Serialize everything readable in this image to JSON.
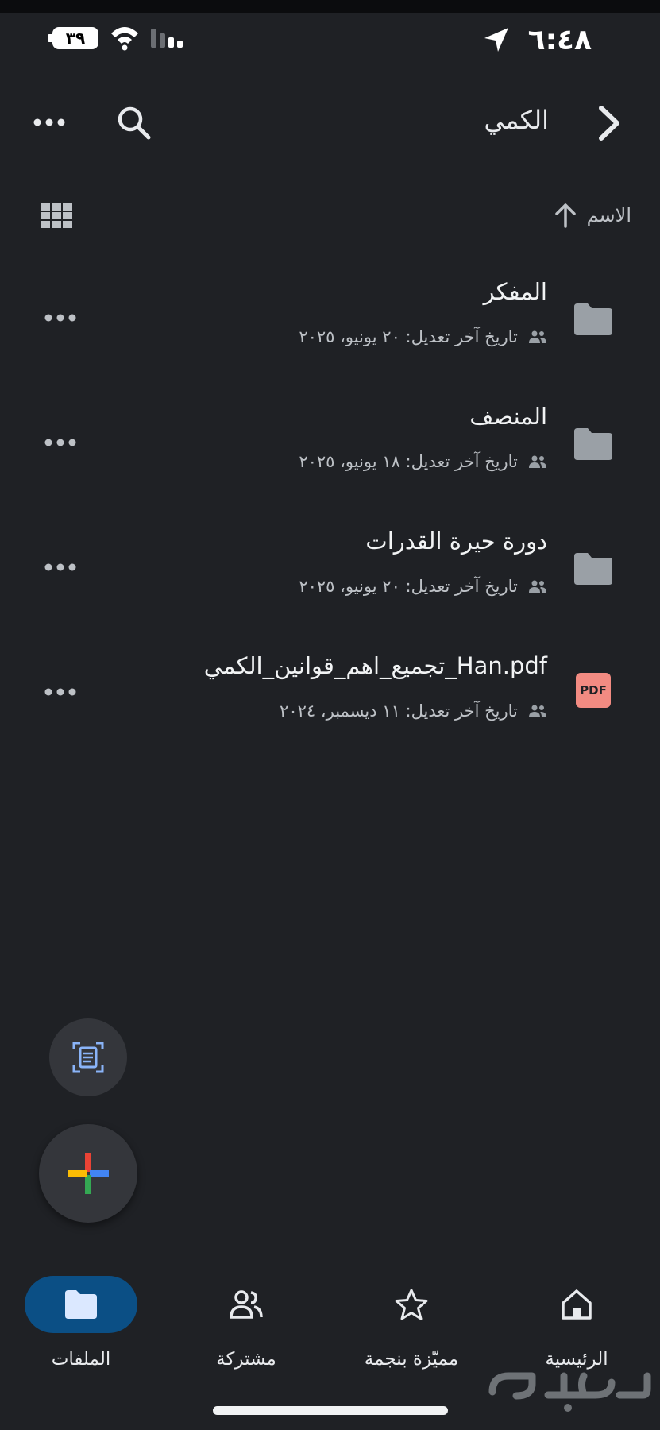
{
  "status_bar": {
    "time": "٦:٤٨",
    "battery": "٣٩"
  },
  "header": {
    "title": "الكمي",
    "icons": [
      "chevron-right-icon",
      "search-icon",
      "more-horizontal-icon"
    ]
  },
  "sort": {
    "label": "الاسم",
    "direction_icon": "arrow-up-icon",
    "view_toggle_icon": "grid-view-icon"
  },
  "files": [
    {
      "name": "المفكر",
      "type": "folder",
      "meta": "تاريخ آخر تعديل: ٢٠ يونيو، ٢٠٢٥",
      "shared": true
    },
    {
      "name": "المنصف",
      "type": "folder",
      "meta": "تاريخ آخر تعديل: ١٨ يونيو، ٢٠٢٥",
      "shared": true
    },
    {
      "name": "دورة حيرة القدرات",
      "type": "folder",
      "meta": "تاريخ آخر تعديل: ٢٠ يونيو، ٢٠٢٥",
      "shared": true
    },
    {
      "name": "تجميع_اهم_قوانين_الكمي_Han.pdf",
      "type": "pdf",
      "badge": "PDF",
      "meta": "تاريخ آخر تعديل: ١١ ديسمبر، ٢٠٢٤",
      "shared": true
    }
  ],
  "fabs": {
    "scan_icon": "document-scan-icon",
    "new_icon": "plus-icon"
  },
  "bottom_nav": [
    {
      "id": "home",
      "label": "الرئيسية",
      "icon": "home-icon",
      "active": false
    },
    {
      "id": "starred",
      "label": "مميّزة بنجمة",
      "icon": "star-icon",
      "active": false
    },
    {
      "id": "shared",
      "label": "مشتركة",
      "icon": "people-icon",
      "active": false
    },
    {
      "id": "files",
      "label": "الملفات",
      "icon": "folder-icon",
      "active": true
    }
  ],
  "colors": {
    "background": "#1f2125",
    "active_nav": "#0b4f85",
    "pdf_badge": "#f28b82",
    "google_blue": "#4285f4",
    "google_red": "#ea4335",
    "google_yellow": "#fbbc04",
    "google_green": "#34a853"
  },
  "watermark": "حراج"
}
